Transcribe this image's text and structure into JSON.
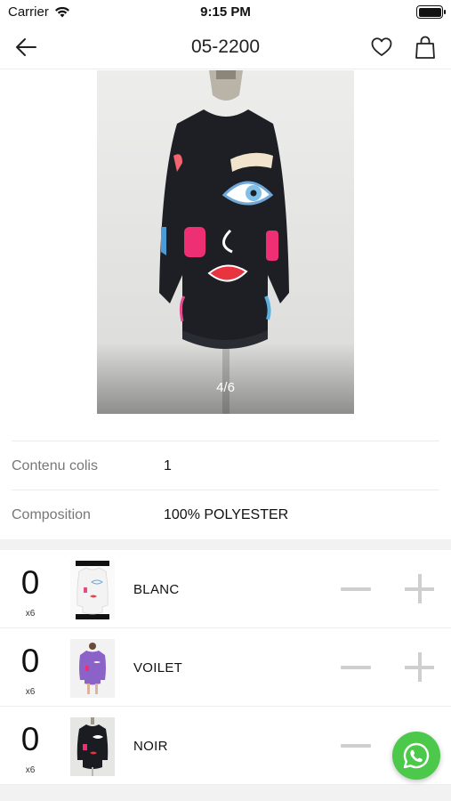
{
  "status_bar": {
    "carrier": "Carrier",
    "time": "9:15 PM",
    "wifi_icon": "wifi-icon",
    "battery_icon": "battery-icon"
  },
  "nav": {
    "title": "05-2200",
    "back_icon": "arrow-left-icon",
    "favorite_icon": "heart-icon",
    "cart_icon": "shopping-bag-icon"
  },
  "gallery": {
    "counter": "4/6",
    "current_image": 4,
    "total_images": 6,
    "subject": "black long-sleeve dress with face print on mannequin"
  },
  "specs": [
    {
      "label": "Contenu colis",
      "value": "1"
    },
    {
      "label": "Composition",
      "value": "100% POLYESTER"
    }
  ],
  "variants": [
    {
      "quantity": "0",
      "pack": "x6",
      "color": "BLANC",
      "thumb_color": "#f4f4f4"
    },
    {
      "quantity": "0",
      "pack": "x6",
      "color": "VOILET",
      "thumb_color": "#8a62c8"
    },
    {
      "quantity": "0",
      "pack": "x6",
      "color": "NOIR",
      "thumb_color": "#1b1b22"
    }
  ],
  "controls": {
    "minus_icon": "minus-icon",
    "plus_icon": "plus-icon"
  },
  "colors": {
    "accent_whatsapp": "#4cc84a",
    "stepper_gray": "#cfcfcf",
    "divider": "#ececec"
  },
  "floating": {
    "whatsapp_icon": "whatsapp-icon"
  }
}
